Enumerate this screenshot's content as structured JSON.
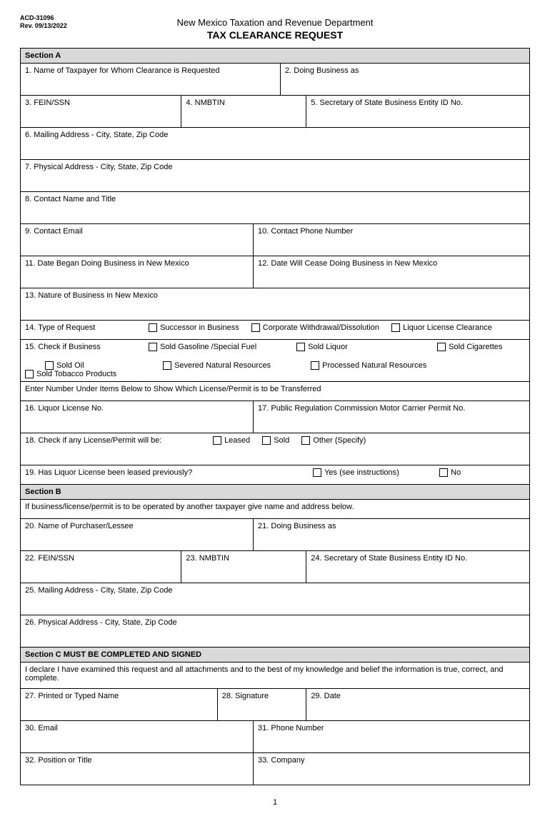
{
  "meta": {
    "form_no": "ACD-31096",
    "rev": "Rev. 09/13/2022"
  },
  "header": {
    "dept": "New Mexico Taxation and Revenue Department",
    "title": "TAX CLEARANCE REQUEST"
  },
  "sectionA": {
    "heading": "Section A",
    "f1": "1.  Name of Taxpayer for Whom Clearance is Requested",
    "f2": "2.  Doing Business as",
    "f3": "3.  FEIN/SSN",
    "f4": "4.  NMBTIN",
    "f5": "5.  Secretary of State Business Entity ID No.",
    "f6": "6.  Mailing Address - City, State, Zip Code",
    "f7": "7.  Physical Address - City, State, Zip Code",
    "f8": "8.  Contact Name and Title",
    "f9": "9.  Contact Email",
    "f10": "10.  Contact Phone Number",
    "f11": "11.  Date Began Doing Business in New Mexico",
    "f12": "12.  Date Will Cease Doing Business in New Mexico",
    "f13": "13.  Nature of Business in New Mexico",
    "f14": {
      "label": "14.  Type of Request",
      "opts": [
        "Successor in Business",
        "Corporate Withdrawal/Dissolution",
        "Liquor License Clearance"
      ]
    },
    "f15": {
      "label": "15.  Check if Business",
      "row1": [
        "Sold Gasoline /Special Fuel",
        "Sold Liquor",
        "Sold Cigarettes"
      ],
      "row2_indent": "Sold Oil",
      "row2": [
        "Severed Natural Resources",
        "Processed Natural Resources",
        "Sold Tobacco Products"
      ]
    },
    "transfer_note": "Enter Number Under Items Below to Show Which License/Permit is to be Transferred",
    "f16": "16.  Liquor License No.",
    "f17": "17.  Public Regulation Commission Motor Carrier Permit No.",
    "f18": {
      "label": "18.  Check if any License/Permit will be:",
      "opts": [
        "Leased",
        "Sold",
        "Other (Specify)"
      ]
    },
    "f19": {
      "label": "19.  Has Liquor License been leased previously?",
      "opts": [
        "Yes (see instructions)",
        "No"
      ]
    }
  },
  "sectionB": {
    "heading": "Section B",
    "note": "If business/license/permit is to be operated by another taxpayer give name and address below.",
    "f20": "20.  Name of Purchaser/Lessee",
    "f21": "21.  Doing Business as",
    "f22": "22.  FEIN/SSN",
    "f23": "23.  NMBTIN",
    "f24": "24. Secretary of State Business Entity ID No.",
    "f25": "25.  Mailing Address - City, State, Zip Code",
    "f26": "26.  Physical Address - City, State, Zip Code"
  },
  "sectionC": {
    "heading": "Section C  MUST BE COMPLETED AND SIGNED",
    "decl": "I declare I have examined this request and all attachments and to the best of my knowledge and belief the information is true, correct, and complete.",
    "f27": "27.  Printed or Typed Name",
    "f28": "28.  Signature",
    "f29": "29.  Date",
    "f30": "30.  Email",
    "f31": "31.  Phone Number",
    "f32": "32.  Position or Title",
    "f33": "33.  Company"
  },
  "page": "1"
}
